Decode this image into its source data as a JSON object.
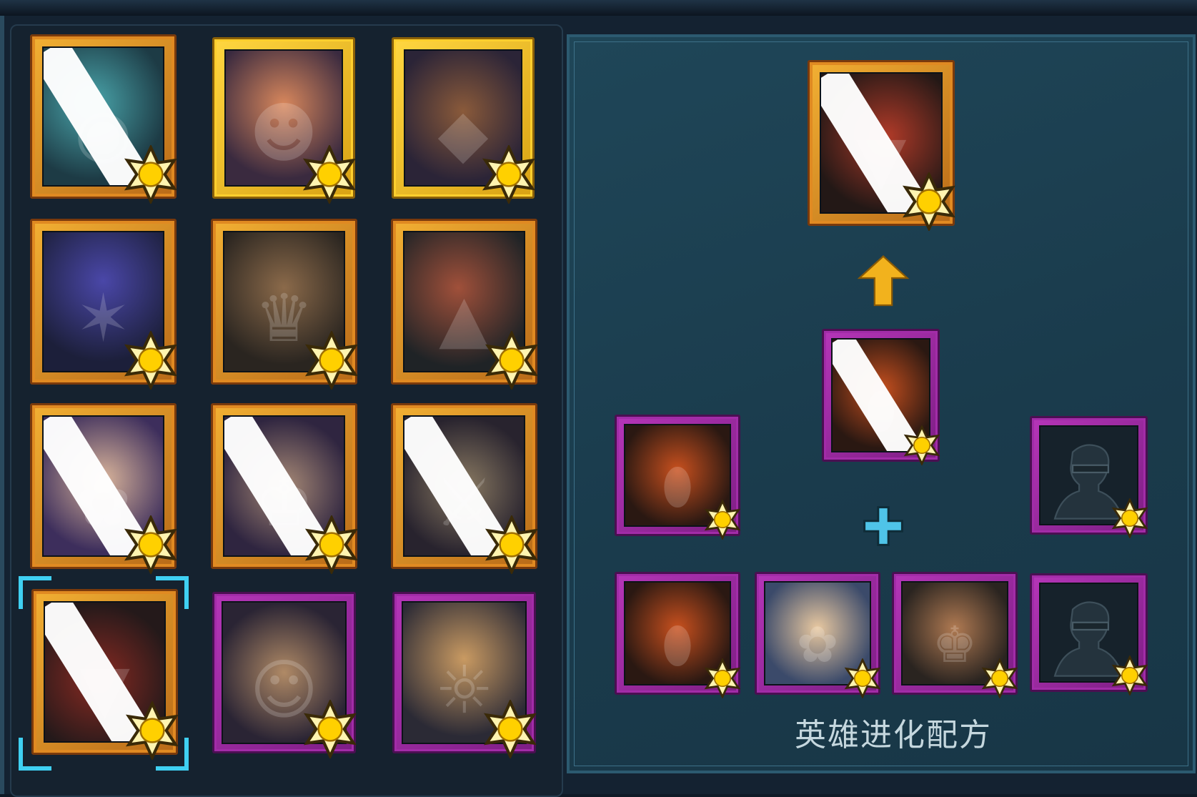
{
  "recipe": {
    "title": "英雄进化配方"
  },
  "colors": {
    "legendary_frame": "#e08a22",
    "gold_frame": "#ffcf2e",
    "epic_frame": "#a22ca8",
    "selection": "#3fd0f2",
    "arrow": "#f2b21d",
    "plus": "#4fc4e8"
  },
  "hero_grid": [
    {
      "portrait": "cyclops-robot-portrait",
      "rarity": "legendary",
      "star-icon": "star-badge-icon"
    },
    {
      "portrait": "bubblegum-girl-portrait",
      "rarity": "gold"
    },
    {
      "portrait": "veiled-priestess-portrait",
      "rarity": "gold"
    },
    {
      "portrait": "duck-hat-wizard-portrait",
      "rarity": "legendary"
    },
    {
      "portrait": "crowned-warrior-portrait",
      "rarity": "legendary"
    },
    {
      "portrait": "golden-dragon-portrait",
      "rarity": "legendary"
    },
    {
      "portrait": "blue-haired-sorceress-portrait",
      "rarity": "legendary"
    },
    {
      "portrait": "goggle-old-king-portrait",
      "rarity": "legendary"
    },
    {
      "portrait": "visor-knight-portrait",
      "rarity": "legendary"
    },
    {
      "portrait": "red-dragon-portrait",
      "rarity": "legendary",
      "selected": true
    },
    {
      "portrait": "goggle-merchant-portrait",
      "rarity": "epic"
    },
    {
      "portrait": "eyepatch-pilot-portrait",
      "rarity": "epic"
    }
  ],
  "evolution": {
    "result": "red-dragon-portrait",
    "base": "lava-egg-portrait",
    "materials_row1": [
      "lava-egg-portrait",
      "silhouette-portrait"
    ],
    "materials_row2": [
      "lava-egg-portrait",
      "blonde-elf-portrait",
      "bearded-king-portrait",
      "silhouette-portrait"
    ]
  }
}
